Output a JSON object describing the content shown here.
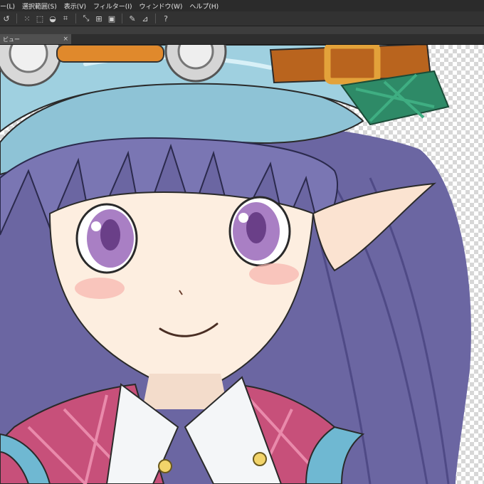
{
  "menubar": {
    "items": [
      "ー(L)",
      "選択範囲(S)",
      "表示(V)",
      "フィルター(I)",
      "ウィンドウ(W)",
      "ヘルプ(H)"
    ]
  },
  "toolbar": {
    "icons": [
      "rotate-icon",
      "select-all-icon",
      "deselect-icon",
      "invert-selection-icon",
      "crop-icon",
      "transform-icon",
      "scale-icon",
      "fill-icon",
      "brush-icon",
      "ruler-icon",
      "help-icon"
    ]
  },
  "tab": {
    "label": "ビュー",
    "close": "×"
  },
  "canvas": {
    "subject": "anime girl illustration",
    "colors": {
      "hair": "#6f6aa8",
      "hat": "#8ec3d6",
      "skin": "#fdeee0",
      "eyes": "#a97fc4",
      "goggle_rim": "#c7c7c7",
      "strap": "#b9641e",
      "buckle": "#e3a23a",
      "green_patch": "#2e8a67",
      "plaid": "#c7507a",
      "collar": "#f4f6f8",
      "blush": "#f7b3ad"
    }
  }
}
